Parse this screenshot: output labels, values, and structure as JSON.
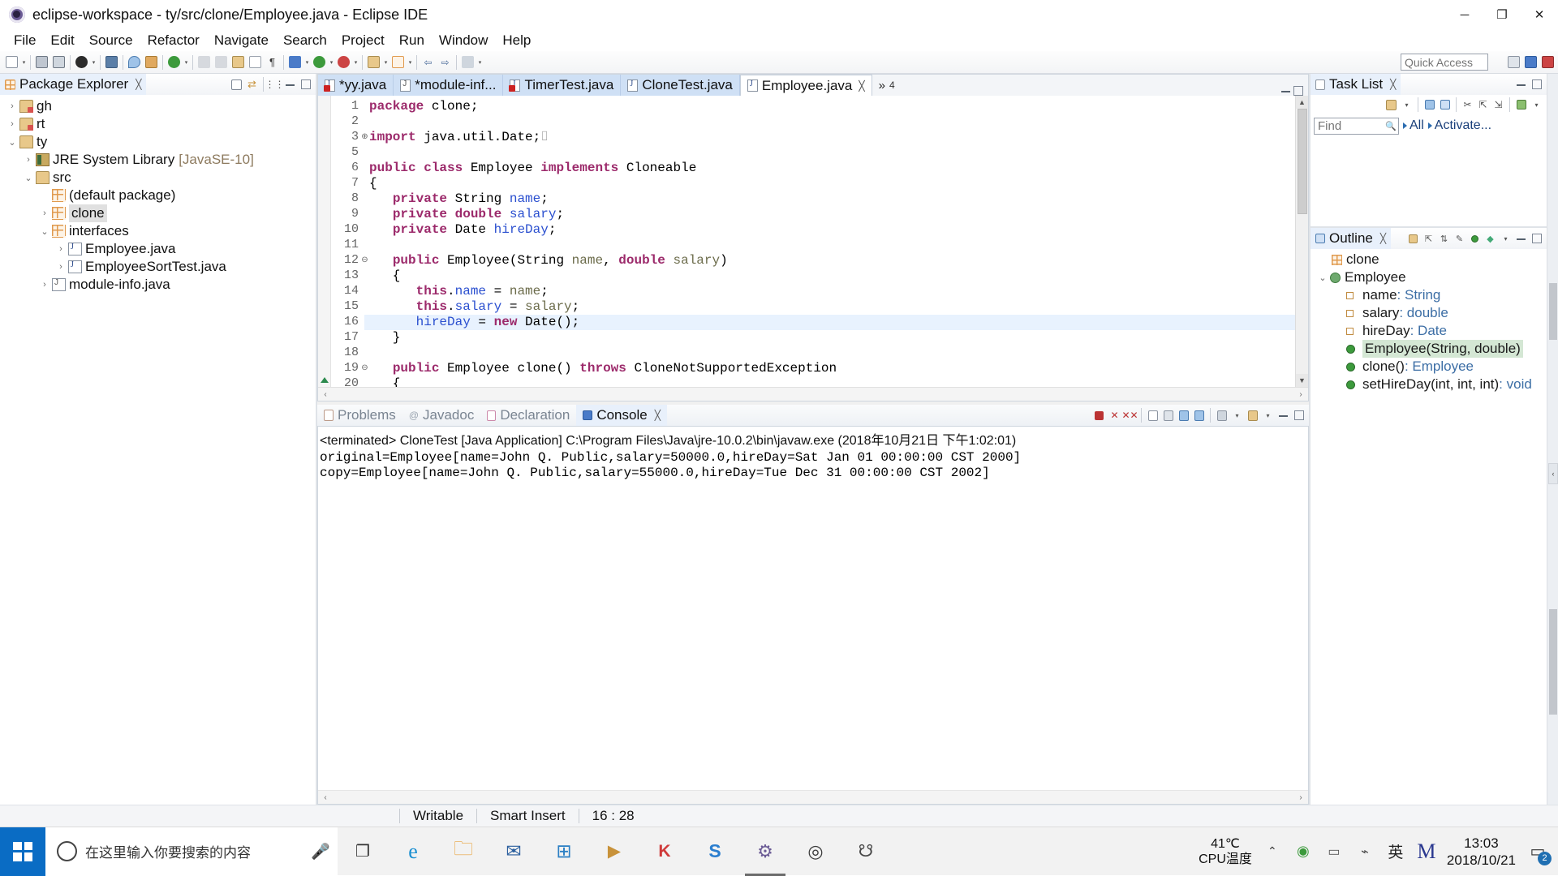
{
  "window": {
    "title": "eclipse-workspace - ty/src/clone/Employee.java - Eclipse IDE",
    "minimize": "─",
    "maximize": "❐",
    "close": "✕"
  },
  "menubar": [
    "File",
    "Edit",
    "Source",
    "Refactor",
    "Navigate",
    "Search",
    "Project",
    "Run",
    "Window",
    "Help"
  ],
  "toolbar": {
    "quick_access_placeholder": "Quick Access",
    "quick_access_value": "Quick Access"
  },
  "package_explorer": {
    "title": "Package Explorer",
    "close": "╳",
    "tree": [
      {
        "label": "gh",
        "indent": 0,
        "twisty": "›",
        "icon": "java-project-closed-icon"
      },
      {
        "label": "rt",
        "indent": 0,
        "twisty": "›",
        "icon": "java-project-closed-icon"
      },
      {
        "label": "ty",
        "indent": 0,
        "twisty": "⌄",
        "icon": "java-project-open-icon"
      },
      {
        "label": "JRE System Library",
        "indent": 1,
        "twisty": "›",
        "icon": "jre-library-icon",
        "suffix": "[JavaSE-10]"
      },
      {
        "label": "src",
        "indent": 1,
        "twisty": "⌄",
        "icon": "source-folder-icon"
      },
      {
        "label": "(default package)",
        "indent": 2,
        "twisty": "",
        "icon": "package-icon"
      },
      {
        "label": "clone",
        "indent": 2,
        "twisty": "›",
        "icon": "package-icon",
        "selected": true
      },
      {
        "label": "interfaces",
        "indent": 2,
        "twisty": "⌄",
        "icon": "package-icon"
      },
      {
        "label": "Employee.java",
        "indent": 3,
        "twisty": "›",
        "icon": "java-file-icon"
      },
      {
        "label": "EmployeeSortTest.java",
        "indent": 3,
        "twisty": "›",
        "icon": "java-file-icon"
      },
      {
        "label": "module-info.java",
        "indent": 2,
        "twisty": "›",
        "icon": "module-info-icon"
      }
    ]
  },
  "editor": {
    "tabs": [
      {
        "label": "*yy.java",
        "dirty": true,
        "error": true,
        "active": false,
        "close": ""
      },
      {
        "label": "*module-inf...",
        "dirty": true,
        "error": false,
        "active": false,
        "close": ""
      },
      {
        "label": "TimerTest.java",
        "dirty": false,
        "error": true,
        "active": false,
        "close": ""
      },
      {
        "label": "CloneTest.java",
        "dirty": false,
        "error": false,
        "active": false,
        "close": ""
      },
      {
        "label": "Employee.java",
        "dirty": false,
        "error": false,
        "active": true,
        "close": "╳"
      }
    ],
    "more_tabs": "»",
    "more_count": "4",
    "lines": [
      {
        "n": "1",
        "fold": "",
        "marker": "",
        "highlight": false,
        "tokens": [
          {
            "t": "package ",
            "c": "kw"
          },
          {
            "t": "clone;",
            "c": ""
          }
        ]
      },
      {
        "n": "2",
        "fold": "",
        "marker": "",
        "highlight": false,
        "tokens": []
      },
      {
        "n": "3",
        "fold": "⊕",
        "marker": "",
        "highlight": false,
        "tokens": [
          {
            "t": "import ",
            "c": "kw"
          },
          {
            "t": "java.util.Date;⎕",
            "c": ""
          }
        ]
      },
      {
        "n": "5",
        "fold": "",
        "marker": "",
        "highlight": false,
        "tokens": []
      },
      {
        "n": "6",
        "fold": "",
        "marker": "",
        "highlight": false,
        "tokens": [
          {
            "t": "public class ",
            "c": "kw"
          },
          {
            "t": "Employee ",
            "c": ""
          },
          {
            "t": "implements ",
            "c": "kw"
          },
          {
            "t": "Cloneable",
            "c": ""
          }
        ]
      },
      {
        "n": "7",
        "fold": "",
        "marker": "",
        "highlight": false,
        "tokens": [
          {
            "t": "{",
            "c": ""
          }
        ]
      },
      {
        "n": "8",
        "fold": "",
        "marker": "",
        "highlight": false,
        "tokens": [
          {
            "t": "    private ",
            "c": "kw"
          },
          {
            "t": "String ",
            "c": ""
          },
          {
            "t": "name",
            "c": "fld"
          },
          {
            "t": ";",
            "c": ""
          }
        ]
      },
      {
        "n": "9",
        "fold": "",
        "marker": "",
        "highlight": false,
        "tokens": [
          {
            "t": "    private double ",
            "c": "kw"
          },
          {
            "t": "salary",
            "c": "fld"
          },
          {
            "t": ";",
            "c": ""
          }
        ]
      },
      {
        "n": "10",
        "fold": "",
        "marker": "",
        "highlight": false,
        "tokens": [
          {
            "t": "    private ",
            "c": "kw"
          },
          {
            "t": "Date ",
            "c": ""
          },
          {
            "t": "hireDay",
            "c": "fld"
          },
          {
            "t": ";",
            "c": ""
          }
        ]
      },
      {
        "n": "11",
        "fold": "",
        "marker": "",
        "highlight": false,
        "tokens": []
      },
      {
        "n": "12",
        "fold": "⊖",
        "marker": "block",
        "highlight": false,
        "tokens": [
          {
            "t": "    public ",
            "c": "kw"
          },
          {
            "t": "Employee(String ",
            "c": ""
          },
          {
            "t": "name",
            "c": "loc"
          },
          {
            "t": ", ",
            "c": ""
          },
          {
            "t": "double ",
            "c": "kw"
          },
          {
            "t": "salary",
            "c": "loc"
          },
          {
            "t": ")",
            "c": ""
          }
        ]
      },
      {
        "n": "13",
        "fold": "",
        "marker": "block",
        "highlight": false,
        "tokens": [
          {
            "t": "    {",
            "c": ""
          }
        ]
      },
      {
        "n": "14",
        "fold": "",
        "marker": "block",
        "highlight": false,
        "tokens": [
          {
            "t": "        this",
            "c": "kw"
          },
          {
            "t": ".",
            "c": ""
          },
          {
            "t": "name",
            "c": "fld"
          },
          {
            "t": " = ",
            "c": ""
          },
          {
            "t": "name",
            "c": "loc"
          },
          {
            "t": ";",
            "c": ""
          }
        ]
      },
      {
        "n": "15",
        "fold": "",
        "marker": "block",
        "highlight": false,
        "tokens": [
          {
            "t": "        this",
            "c": "kw"
          },
          {
            "t": ".",
            "c": ""
          },
          {
            "t": "salary",
            "c": "fld"
          },
          {
            "t": " = ",
            "c": ""
          },
          {
            "t": "salary",
            "c": "loc"
          },
          {
            "t": ";",
            "c": ""
          }
        ]
      },
      {
        "n": "16",
        "fold": "",
        "marker": "block",
        "highlight": true,
        "tokens": [
          {
            "t": "        ",
            "c": ""
          },
          {
            "t": "hireDay",
            "c": "fld"
          },
          {
            "t": " = ",
            "c": ""
          },
          {
            "t": "new ",
            "c": "kw"
          },
          {
            "t": "Date();",
            "c": ""
          }
        ]
      },
      {
        "n": "17",
        "fold": "",
        "marker": "block",
        "highlight": false,
        "tokens": [
          {
            "t": "    }",
            "c": ""
          }
        ]
      },
      {
        "n": "18",
        "fold": "",
        "marker": "",
        "highlight": false,
        "tokens": []
      },
      {
        "n": "19",
        "fold": "⊖",
        "marker": "override",
        "highlight": false,
        "tokens": [
          {
            "t": "    public ",
            "c": "kw"
          },
          {
            "t": "Employee clone() ",
            "c": ""
          },
          {
            "t": "throws ",
            "c": "kw"
          },
          {
            "t": "CloneNotSupportedException",
            "c": ""
          }
        ]
      },
      {
        "n": "20",
        "fold": "",
        "marker": "",
        "highlight": false,
        "tokens": [
          {
            "t": "    {",
            "c": ""
          }
        ]
      }
    ]
  },
  "task_list": {
    "title": "Task List",
    "close": "╳",
    "find_placeholder": "Find",
    "find_value": "Find",
    "all_label": "All",
    "activate_label": "Activate..."
  },
  "outline": {
    "title": "Outline",
    "close": "╳",
    "items": [
      {
        "label": "clone",
        "indent": 0,
        "icon": "package-icon",
        "twisty": "",
        "type": ""
      },
      {
        "label": "Employee",
        "indent": 0,
        "icon": "class-icon",
        "twisty": "⌄",
        "type": ""
      },
      {
        "label": "name",
        "indent": 1,
        "icon": "field-private-icon",
        "twisty": "",
        "type": " : String"
      },
      {
        "label": "salary",
        "indent": 1,
        "icon": "field-private-icon",
        "twisty": "",
        "type": " : double"
      },
      {
        "label": "hireDay",
        "indent": 1,
        "icon": "field-private-icon",
        "twisty": "",
        "type": " : Date"
      },
      {
        "label": "Employee(String, double)",
        "indent": 1,
        "icon": "constructor-icon",
        "twisty": "",
        "type": "",
        "selected": true
      },
      {
        "label": "clone()",
        "indent": 1,
        "icon": "method-public-icon",
        "twisty": "",
        "type": " : Employee"
      },
      {
        "label": "setHireDay(int, int, int)",
        "indent": 1,
        "icon": "method-public-icon",
        "twisty": "",
        "type": " : void"
      }
    ]
  },
  "console": {
    "tabs": [
      {
        "label": "Problems",
        "active": false,
        "icon": "problems-icon"
      },
      {
        "label": "Javadoc",
        "active": false,
        "icon": "javadoc-icon"
      },
      {
        "label": "Declaration",
        "active": false,
        "icon": "declaration-icon"
      },
      {
        "label": "Console",
        "active": true,
        "icon": "console-icon",
        "close": "╳"
      }
    ],
    "status_line": "<terminated> CloneTest [Java Application] C:\\Program Files\\Java\\jre-10.0.2\\bin\\javaw.exe (2018年10月21日 下午1:02:01)",
    "output": [
      "original=Employee[name=John Q. Public,salary=50000.0,hireDay=Sat Jan 01 00:00:00 CST 2000]",
      "copy=Employee[name=John Q. Public,salary=55000.0,hireDay=Tue Dec 31 00:00:00 CST 2002]"
    ]
  },
  "statusbar": {
    "writable": "Writable",
    "insert_mode": "Smart Insert",
    "position": "16 : 28"
  },
  "taskbar": {
    "search_placeholder": "在这里输入你要搜索的内容",
    "temp_value": "41℃",
    "temp_label": "CPU温度",
    "ime": "英",
    "clock_time": "13:03",
    "clock_date": "2018/10/21",
    "notify_count": "2",
    "apps": [
      {
        "name": "task-view-icon",
        "glyph": "❐",
        "color": "#333333"
      },
      {
        "name": "edge-browser-icon",
        "glyph": "e",
        "color": "#1a8fd1"
      },
      {
        "name": "file-explorer-icon",
        "glyph": "▬",
        "color": "#e8a33d"
      },
      {
        "name": "mail-icon",
        "glyph": "✉",
        "color": "#2b5f9e"
      },
      {
        "name": "microsoft-store-icon",
        "glyph": "⊞",
        "color": "#2b7fc4"
      },
      {
        "name": "video-app-icon",
        "glyph": "▶",
        "color": "#c8923a"
      },
      {
        "name": "kingsoft-icon",
        "glyph": "K",
        "color": "#cf3a3a"
      },
      {
        "name": "sogou-input-icon",
        "glyph": "S",
        "color": "#2b7ecf"
      },
      {
        "name": "eclipse-icon",
        "glyph": "⚙",
        "color": "#6b5b95"
      },
      {
        "name": "chrome-icon",
        "glyph": "◎",
        "color": "#3b3b3b"
      },
      {
        "name": "people-icon",
        "glyph": "☻",
        "color": "#4a4a4a"
      }
    ]
  },
  "colors": {
    "accent": "#cfe0f5",
    "keyword": "#9c2a6b",
    "field": "#2a4fcf",
    "local": "#6b6b4a",
    "selection": "#e8f2fe",
    "taskbar_start": "#0a6cc4"
  }
}
